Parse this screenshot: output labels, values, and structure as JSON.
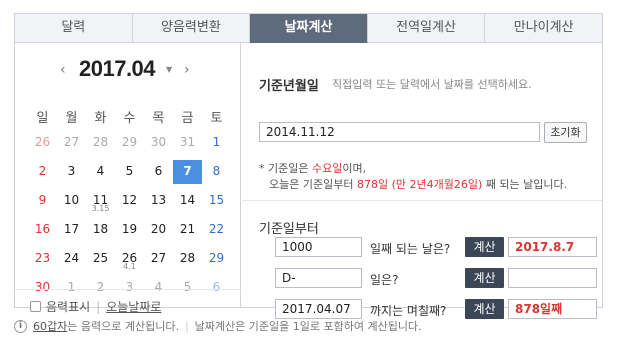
{
  "tabs": [
    {
      "label": "달력",
      "active": false
    },
    {
      "label": "양음력변환",
      "active": false
    },
    {
      "label": "날짜계산",
      "active": true
    },
    {
      "label": "전역일계산",
      "active": false
    },
    {
      "label": "만나이계산",
      "active": false
    }
  ],
  "calendar": {
    "prev_icon": "‹",
    "next_icon": "›",
    "month": "2017.04",
    "dropdown_icon": "▼",
    "weekdays": [
      "일",
      "월",
      "화",
      "수",
      "목",
      "금",
      "토"
    ],
    "weeks": [
      [
        {
          "d": "26",
          "o": true
        },
        {
          "d": "27",
          "o": true
        },
        {
          "d": "28",
          "o": true
        },
        {
          "d": "29",
          "o": true
        },
        {
          "d": "30",
          "o": true
        },
        {
          "d": "31",
          "o": true
        },
        {
          "d": "1"
        }
      ],
      [
        {
          "d": "2"
        },
        {
          "d": "3"
        },
        {
          "d": "4"
        },
        {
          "d": "5"
        },
        {
          "d": "6"
        },
        {
          "d": "7",
          "sel": true
        },
        {
          "d": "8"
        }
      ],
      [
        {
          "d": "9"
        },
        {
          "d": "10"
        },
        {
          "d": "11",
          "sub": "3.15"
        },
        {
          "d": "12"
        },
        {
          "d": "13"
        },
        {
          "d": "14"
        },
        {
          "d": "15"
        }
      ],
      [
        {
          "d": "16"
        },
        {
          "d": "17"
        },
        {
          "d": "18"
        },
        {
          "d": "19"
        },
        {
          "d": "20"
        },
        {
          "d": "21"
        },
        {
          "d": "22"
        }
      ],
      [
        {
          "d": "23"
        },
        {
          "d": "24"
        },
        {
          "d": "25"
        },
        {
          "d": "26",
          "sub": "4.1"
        },
        {
          "d": "27"
        },
        {
          "d": "28"
        },
        {
          "d": "29"
        }
      ],
      [
        {
          "d": "30"
        },
        {
          "d": "1",
          "o": true
        },
        {
          "d": "2",
          "o": true
        },
        {
          "d": "3",
          "o": true
        },
        {
          "d": "4",
          "o": true
        },
        {
          "d": "5",
          "o": true
        },
        {
          "d": "6",
          "o": true
        }
      ]
    ],
    "lunar_label": "음력표시",
    "separator": "|",
    "today_link": "오늘날짜로"
  },
  "base": {
    "title": "기준년월일",
    "hint": "직접입력 또는 달력에서 날짜를 선택하세요.",
    "value": "2014.11.12",
    "reset": "초기화",
    "note1_pre": "* 기준일은 ",
    "note1_day": "수요일",
    "note1_post": "이며,",
    "note2_pre": "오늘은 기준일부터 ",
    "note2_days": "878일 (만 2년4개월26일)",
    "note2_post": " 째 되는 날입니다."
  },
  "calc": {
    "title": "기준일부터",
    "rows": [
      {
        "input": "1000",
        "label": "일째 되는 날은?",
        "button": "계산",
        "result": "2017.8.7"
      },
      {
        "input": "D-",
        "label": "일은?",
        "button": "계산",
        "result": ""
      },
      {
        "input": "2017.04.07",
        "label": "까지는 며칠째?",
        "button": "계산",
        "result": "878일째"
      }
    ]
  },
  "info": {
    "icon": "i",
    "link": "60갑자",
    "text1": "는 음력으로 계산됩니다.",
    "bar": "|",
    "text2": "날짜계산은 기준일을 1일로 포함하여 계산됩니다."
  },
  "colors": {
    "accent": "#5d6b7d",
    "selected": "#4a8fe0",
    "red": "#dd3333",
    "blue": "#2f6fcf"
  }
}
